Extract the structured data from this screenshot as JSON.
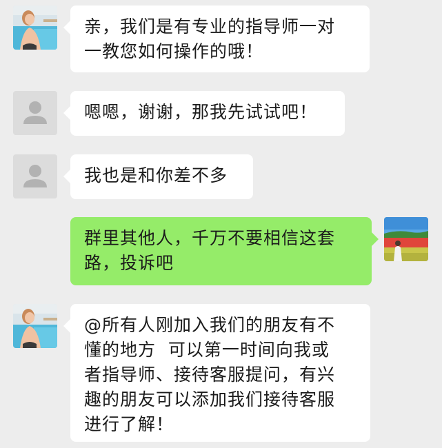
{
  "colors": {
    "background": "#ededed",
    "incoming_bubble": "#ffffff",
    "outgoing_bubble": "#95ec69",
    "text": "#1b1b1b",
    "default_avatar_bg": "#dcdcdc",
    "default_avatar_fg": "#b2b2b2"
  },
  "messages": [
    {
      "sender": "other",
      "avatar": "photo-avatar-woman-pool",
      "text": "亲，我们是有专业的指导师一对\n一教您如何操作的哦！"
    },
    {
      "sender": "other",
      "avatar": "default-user-avatar",
      "text": "嗯嗯，谢谢，那我先试试吧！"
    },
    {
      "sender": "other",
      "avatar": "default-user-avatar",
      "text": "我也是和你差不多"
    },
    {
      "sender": "self",
      "avatar": "photo-avatar-flower-field",
      "text": "群里其他人，千万不要相信这套\n路，投诉吧"
    },
    {
      "sender": "other",
      "avatar": "photo-avatar-woman-pool",
      "text": "@所有人刚加入我们的朋友有不\n懂的地方  可以第一时间向我或\n者指导师、接待客服提问，有兴\n趣的朋友可以添加我们接待客服\n进行了解！"
    }
  ]
}
